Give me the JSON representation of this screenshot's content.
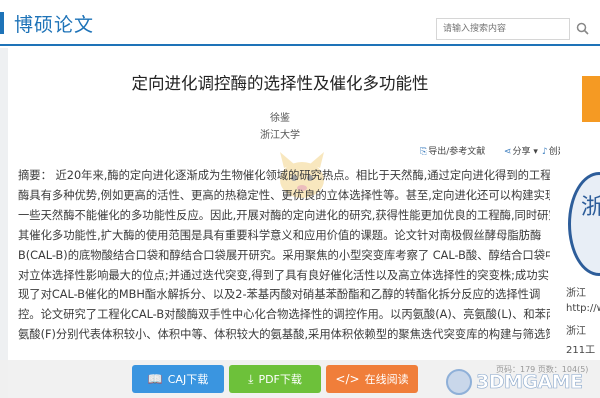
{
  "header": {
    "site_title": "博硕论文",
    "search_placeholder": "请输入搜索内容",
    "search_icon": "search-icon",
    "accent_color": "#1e73b8"
  },
  "paper": {
    "title": "定向进化调控酶的选择性及催化多功能性",
    "author": "徐鉴",
    "institution": "浙江大学"
  },
  "actions": {
    "export": "导出/参考文献",
    "share": "分享",
    "cite": "创建引文跟踪"
  },
  "abstract_lines": [
    "摘要：  近20年来,酶的定向进化逐渐成为生物催化领域的研究热点。相比于天然酶,通过定向进化得到的工程",
    "酶具有多种优势,例如更高的活性、更高的热稳定性、更优良的立体选择性等。甚至,定向进化还可以构建实现",
    "一些天然酶不能催化的多功能性反应。因此,开展对酶的定向进化的研究,获得性能更加优良的工程酶,同时研究",
    "其催化多功能性,扩大酶的使用范围是具有重要科学意义和应用价值的课题。论文针对南极假丝酵母脂肪酶",
    "B(CAL-B)的底物酸结合口袋和醇结合口袋展开研究。采用聚焦的小型突变库考察了 CAL-B酸、醇结合口袋中",
    "对立体选择性影响最大的位点;并通过迭代突变,得到了具有良好催化活性以及高立体选择性的突变株;成功实",
    "现了对CAL-B催化的MBH酯水解拆分、以及2-苯基丙酸对硝基苯酚酯和乙醇的转酯化拆分反应的选择性调",
    "控。论文研究了工程化CAL-B对酸酶双手性中心化合物选择性的调控作用。以丙氨酸(A)、亮氨酸(L)、和苯丙",
    "氨酸(F)分别代表体积较小、体积中等、体积较大的氨基酸,采用体积依赖型的聚焦迭代突变库的构建与筛选策"
  ],
  "side_text": {
    "line1": "浙江",
    "line2": "http://www.",
    "line3": "浙江",
    "line4": "211工"
  },
  "side_colors": {
    "tab": "#f59a23",
    "logo": "#2d5d9a"
  },
  "buttons": {
    "caj": "CAJ下载",
    "pdf": "PDF下载",
    "online": "在线阅读",
    "caj_color": "#3a95e0",
    "pdf_color": "#6dc13a",
    "online_color": "#f07e3a"
  },
  "page_info": "页码：179 页数：104(5)",
  "watermark": "3DMGAME"
}
